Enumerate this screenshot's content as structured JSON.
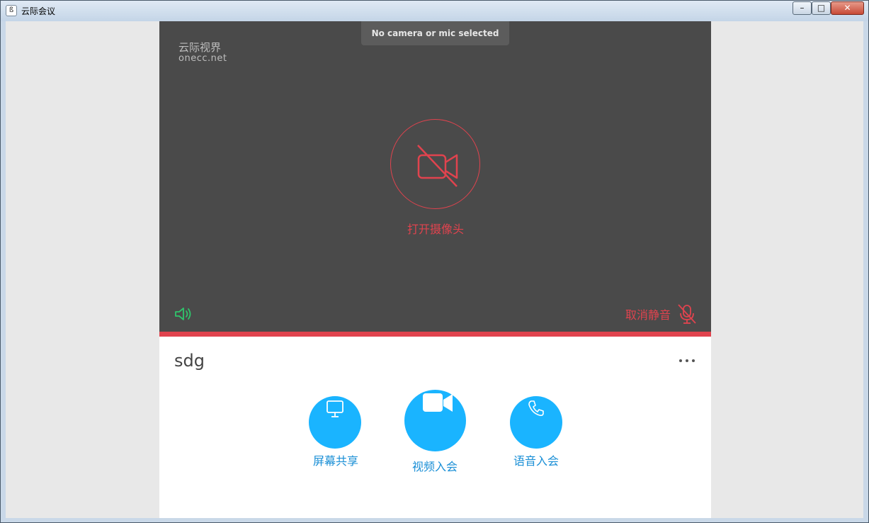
{
  "window": {
    "title": "云际会议",
    "app_icon_glyph": "ß",
    "minimize_glyph": "–",
    "maximize_glyph": "□",
    "close_glyph": "✕"
  },
  "video": {
    "status_message": "No camera or mic selected",
    "watermark_cn": "云际视界",
    "watermark_en": "onecc.net",
    "camera_label": "打开摄像头",
    "unmute_label": "取消静音"
  },
  "panel": {
    "username": "sdg",
    "actions": [
      {
        "label": "屏幕共享",
        "icon": "monitor-icon"
      },
      {
        "label": "视频入会",
        "icon": "video-camera-icon"
      },
      {
        "label": "语音入会",
        "icon": "phone-icon"
      }
    ]
  },
  "colors": {
    "accent_red": "#e0434e",
    "accent_blue": "#1ab4ff",
    "speaker_green": "#2fc46b",
    "video_bg": "#4a4a4a"
  }
}
